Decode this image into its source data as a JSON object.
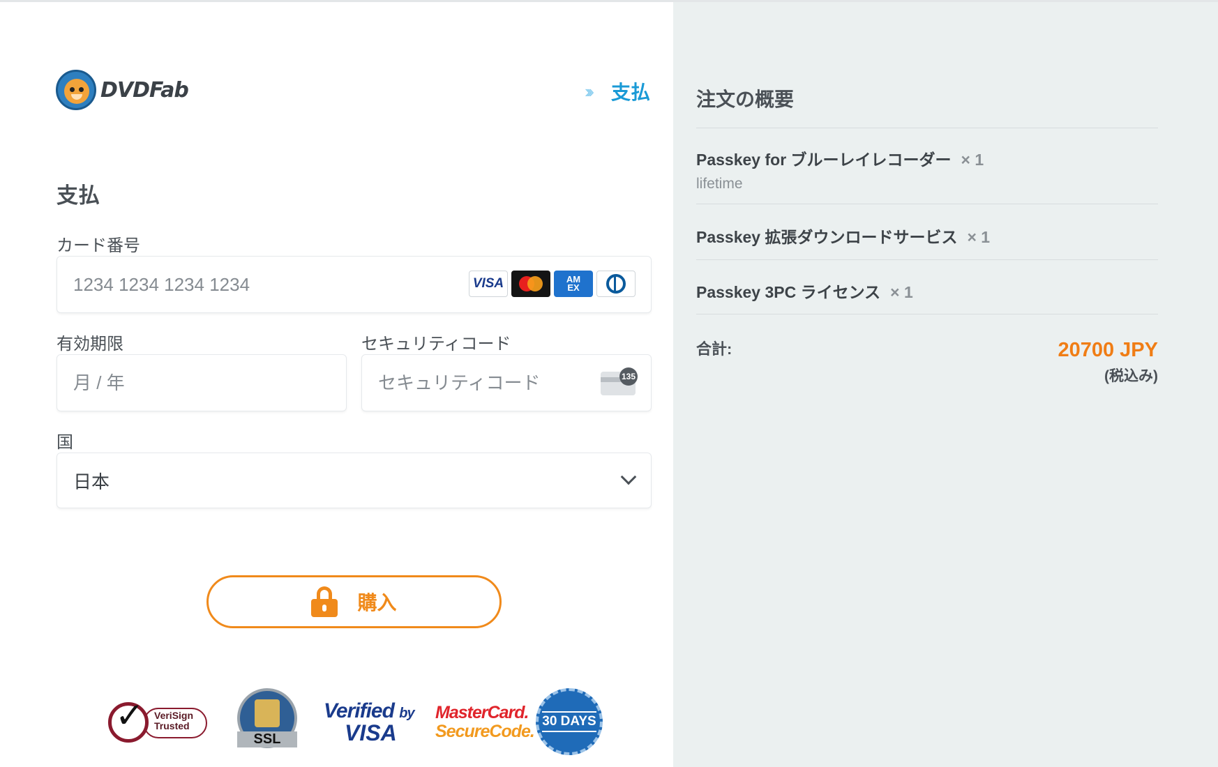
{
  "brand": {
    "name": "DVDFab"
  },
  "step": {
    "chevrons": "›››",
    "label": "支払"
  },
  "payment": {
    "heading": "支払",
    "card_number": {
      "label": "カード番号",
      "placeholder": "1234 1234 1234 1234"
    },
    "card_brands": [
      "VISA",
      "Mastercard",
      "AMEX",
      "Diners Club"
    ],
    "expiry": {
      "label": "有効期限",
      "placeholder": "月 / 年"
    },
    "cvc": {
      "label": "セキュリティコード",
      "placeholder": "セキュリティコード",
      "badge": "135"
    },
    "country": {
      "label": "国",
      "value": "日本"
    },
    "buy_label": "購入"
  },
  "trust_badges": {
    "verisign": "VeriSign Trusted",
    "ssl": "SSL",
    "verified_by": "Verified",
    "verified_by_small": "by",
    "verified_visa": "VISA",
    "mc_line1": "MasterCard.",
    "mc_line2": "SecureCode.",
    "days": "30 DAYS"
  },
  "summary": {
    "title": "注文の概要",
    "items": [
      {
        "name": "Passkey for ブルーレイレコーダー",
        "qty": "× 1",
        "sub": "lifetime"
      },
      {
        "name": "Passkey 拡張ダウンロードサービス",
        "qty": "× 1"
      },
      {
        "name": "Passkey 3PC ライセンス",
        "qty": "× 1"
      }
    ],
    "total_label": "合計:",
    "total_amount": "20700 JPY",
    "total_tax": "(税込み)"
  },
  "colors": {
    "accent": "#f08a1b",
    "link": "#1a9ad6",
    "panel": "#ebf0f0"
  }
}
